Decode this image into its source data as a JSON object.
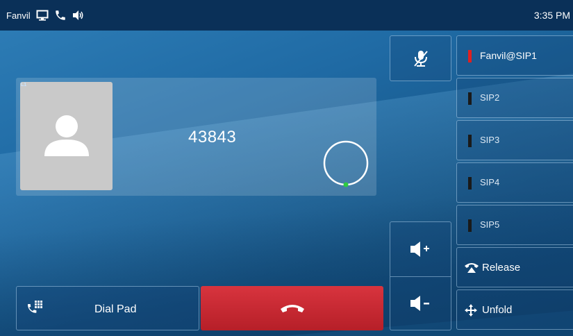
{
  "status_bar": {
    "brand": "Fanvil",
    "icons": [
      "desktop-icon",
      "phone-icon",
      "speaker-icon"
    ],
    "time": "3:35 PM"
  },
  "call": {
    "line_tag": "L1",
    "number": "43843",
    "avatar_icon": "person-icon",
    "status_icon": "ringing-circle-icon"
  },
  "buttons": {
    "dial_pad": "Dial Pad",
    "hangup_icon": "hangup-icon",
    "mute_icon": "mic-mute-icon",
    "volume_up_icon": "volume-up-icon",
    "volume_down_icon": "volume-down-icon"
  },
  "accounts": [
    {
      "label": "Fanvil@SIP1",
      "active": true
    },
    {
      "label": "SIP2",
      "active": false
    },
    {
      "label": "SIP3",
      "active": false
    },
    {
      "label": "SIP4",
      "active": false
    },
    {
      "label": "SIP5",
      "active": false
    }
  ],
  "actions": {
    "release": "Release",
    "unfold": "Unfold"
  },
  "colors": {
    "active_account": "#e02020",
    "hangup": "#c62830",
    "status_bar": "#0a3058"
  }
}
